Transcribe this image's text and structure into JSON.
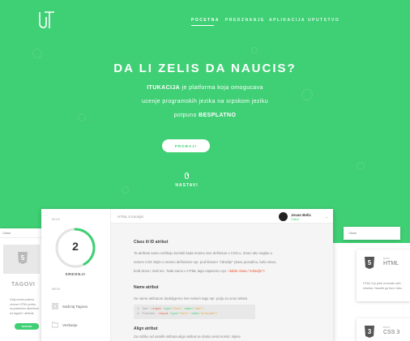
{
  "nav": {
    "items": [
      "POCETNA",
      "PREDZNANJE",
      "APLIKACIJA",
      "UPUTSTVO"
    ],
    "active_index": 0
  },
  "hero": {
    "title": "DA LI ZELIS DA NAUCIS?",
    "line1_brand": "ITUKACIJA",
    "line1_rest": "je platforma koja omogucava",
    "line2": "ucenje programskih jezika na srpskom jeziku",
    "line3_pre": "potpuno",
    "line3_bold": "BESPLATNO",
    "button": "PROBAJ!",
    "continue": "NASTAVI"
  },
  "left_card": {
    "top": "Oblast",
    "thumb_label": "TAGOVI",
    "shield_text": "5",
    "text_lines": [
      "Ovaj modul pokriva",
      "osnove HTML jezika,",
      "sa posebnim akcentom",
      "na tagove i atribute"
    ],
    "button": "NASTAVI"
  },
  "right_cards": {
    "top": "Oblast",
    "card2": {
      "small": "BOPA",
      "title": "HTML",
      "text": "HTML 5 je jezik za izradu web stranica. Naucite ga brzo i lako."
    },
    "card3": {
      "small": "BOPA",
      "title": "CSS 3"
    }
  },
  "app": {
    "sidebar": {
      "level_label": "NIVO",
      "progress_value": 2,
      "progress_fraction": 0.42,
      "progress_sub": "SREDNJI",
      "menu_label": "MENI",
      "items": [
        {
          "label": "Sadrzaj Tagova",
          "icon": "grid-icon"
        },
        {
          "label": "Vezbanje",
          "icon": "folder-icon"
        }
      ]
    },
    "header": {
      "crumb": "HTML 5 tutorijal",
      "user_name": "Jovan Belic",
      "user_status": "Online"
    },
    "doc": {
      "h1": "Class ili ID atribut",
      "p1": [
        "Ta atributa samo razlikuju koristiti kada imamo vise definisan u CSS-u. Znaci ako naglas u",
        "nekom CSS Style-u imamo definisano npr. pod klasom \"zdravlje\" plavu pozadinu, bela slova,",
        "bold slova i mali ton. Tada samo u HTML tagu napisemo npr."
      ],
      "p1_code": "<table class=\"zdravlje\">",
      "h2": "Name atribut",
      "p2": "Se name atributom dodeljujemo ime nekom tagu npr. polju za unos teksta",
      "code_lines": [
        {
          "n": "1.",
          "tag": "<input",
          "attr1": "type=",
          "val1": "\"text\"",
          "attr2": "name=",
          "val2": "\"ime\">"
        },
        {
          "n": "2.",
          "tag": "<input",
          "attr1": "type=",
          "val1": "\"text\"",
          "attr2": "name=",
          "val2": "\"prezime\">"
        }
      ],
      "code_prefix": "Ime:",
      "code_prefix2": "Prezime:",
      "h3": "Align atribut",
      "p3": "Za razliku od ostalih atributa align atribut se dosta cesto koristi. Njime"
    }
  },
  "colors": {
    "accent": "#3fcf74",
    "bg": "#ffffff",
    "orange": "#e8532d"
  }
}
